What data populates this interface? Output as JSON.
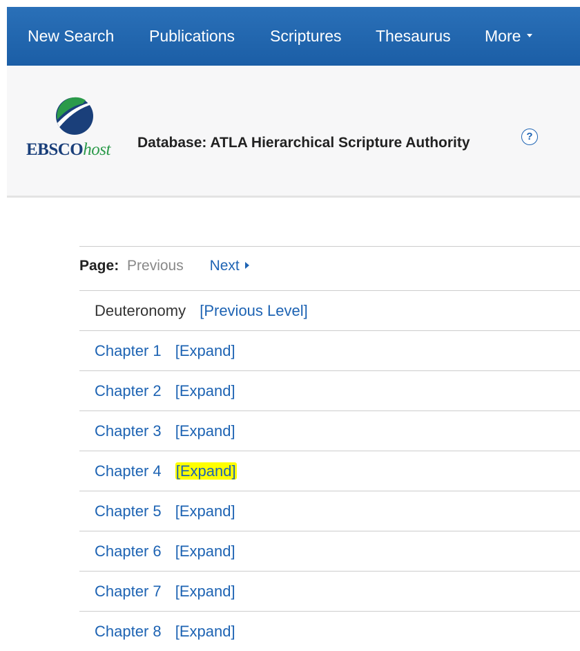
{
  "nav": {
    "items": [
      {
        "label": "New Search"
      },
      {
        "label": "Publications"
      },
      {
        "label": "Scriptures"
      },
      {
        "label": "Thesaurus"
      },
      {
        "label": "More"
      }
    ]
  },
  "header": {
    "logo_main": "EBSCO",
    "logo_suffix": "host",
    "database_title": "Database: ATLA Hierarchical Scripture Authority",
    "help_symbol": "?"
  },
  "pager": {
    "label": "Page:",
    "previous": "Previous",
    "next": "Next"
  },
  "list": {
    "parent": {
      "title": "Deuteronomy",
      "action": "[Previous Level]"
    },
    "rows": [
      {
        "title": "Chapter 1",
        "action": "[Expand]",
        "highlighted": false
      },
      {
        "title": "Chapter 2",
        "action": "[Expand]",
        "highlighted": false
      },
      {
        "title": "Chapter 3",
        "action": "[Expand]",
        "highlighted": false
      },
      {
        "title": "Chapter 4",
        "action": "[Expand]",
        "highlighted": true
      },
      {
        "title": "Chapter 5",
        "action": "[Expand]",
        "highlighted": false
      },
      {
        "title": "Chapter 6",
        "action": "[Expand]",
        "highlighted": false
      },
      {
        "title": "Chapter 7",
        "action": "[Expand]",
        "highlighted": false
      },
      {
        "title": "Chapter 8",
        "action": "[Expand]",
        "highlighted": false
      }
    ]
  },
  "colors": {
    "nav_background": "#1b5ea6",
    "link": "#1d63b3",
    "highlight": "#ffff00",
    "logo_blue": "#1a3f7a",
    "logo_green": "#2b9a4a"
  },
  "icons": {
    "nav_more": "caret-down-icon",
    "pager_next": "triangle-right-icon",
    "help": "help-icon",
    "logo": "ebsco-logo-icon"
  }
}
